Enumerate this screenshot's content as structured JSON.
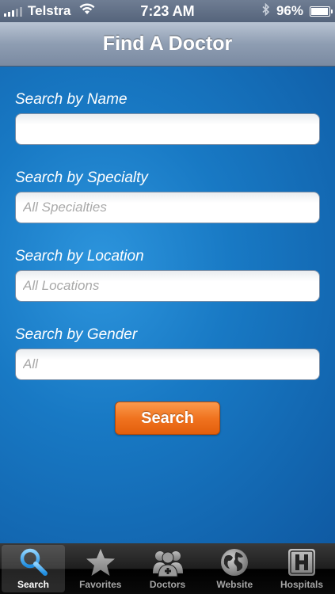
{
  "status_bar": {
    "carrier": "Telstra",
    "time": "7:23 AM",
    "battery": "96%",
    "battery_level": 0.96
  },
  "nav": {
    "title": "Find A Doctor"
  },
  "form": {
    "name": {
      "label": "Search by Name",
      "placeholder": ""
    },
    "specialty": {
      "label": "Search by Specialty",
      "placeholder": "All Specialties"
    },
    "location": {
      "label": "Search by Location",
      "placeholder": "All Locations"
    },
    "gender": {
      "label": "Search by Gender",
      "placeholder": "All"
    },
    "search_button": "Search"
  },
  "tabs": [
    {
      "label": "Search",
      "icon": "magnifier-icon",
      "active": true
    },
    {
      "label": "Favorites",
      "icon": "star-icon",
      "active": false
    },
    {
      "label": "Doctors",
      "icon": "doctors-icon",
      "active": false
    },
    {
      "label": "Website",
      "icon": "globe-icon",
      "active": false
    },
    {
      "label": "Hospitals",
      "icon": "hospital-icon",
      "active": false
    }
  ],
  "colors": {
    "accent": "#f0731f",
    "background": "#1879c4",
    "tab_active_icon": "#3aa6ee"
  }
}
